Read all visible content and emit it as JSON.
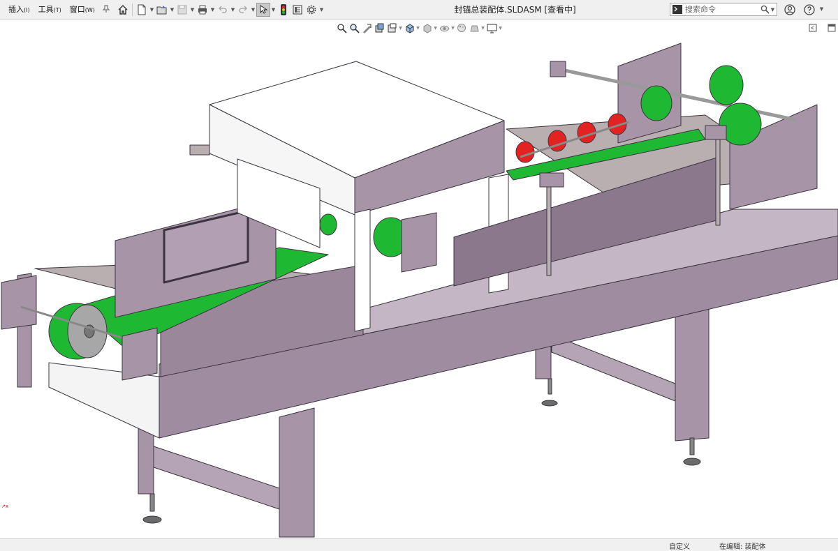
{
  "menu": {
    "items": [
      {
        "label": "插入",
        "accel": "(I)"
      },
      {
        "label": "工具",
        "accel": "(T)"
      },
      {
        "label": "窗口",
        "accel": "(W)"
      }
    ]
  },
  "window": {
    "title": "封锚总装配体.SLDASM [查看中]"
  },
  "search": {
    "placeholder": "搜索命令"
  },
  "status": {
    "left_text": "自定义",
    "right_text": "在编辑: 装配体"
  },
  "colors": {
    "frame": "#a794a7",
    "belt": "#1fb833",
    "roller": "#e32222",
    "hood": "#ffffff",
    "plate": "#b9aeb0",
    "toolbar_bg": "#f0f0f0"
  },
  "icons": [
    "home-icon",
    "new-document-icon",
    "open-folder-icon",
    "save-icon",
    "print-icon",
    "undo-icon",
    "redo-icon",
    "select-arrow-icon",
    "traffic-light-icon",
    "options-icon",
    "settings-gear-icon",
    "terminal-icon",
    "search-icon",
    "user-icon",
    "help-icon",
    "pin-icon"
  ]
}
